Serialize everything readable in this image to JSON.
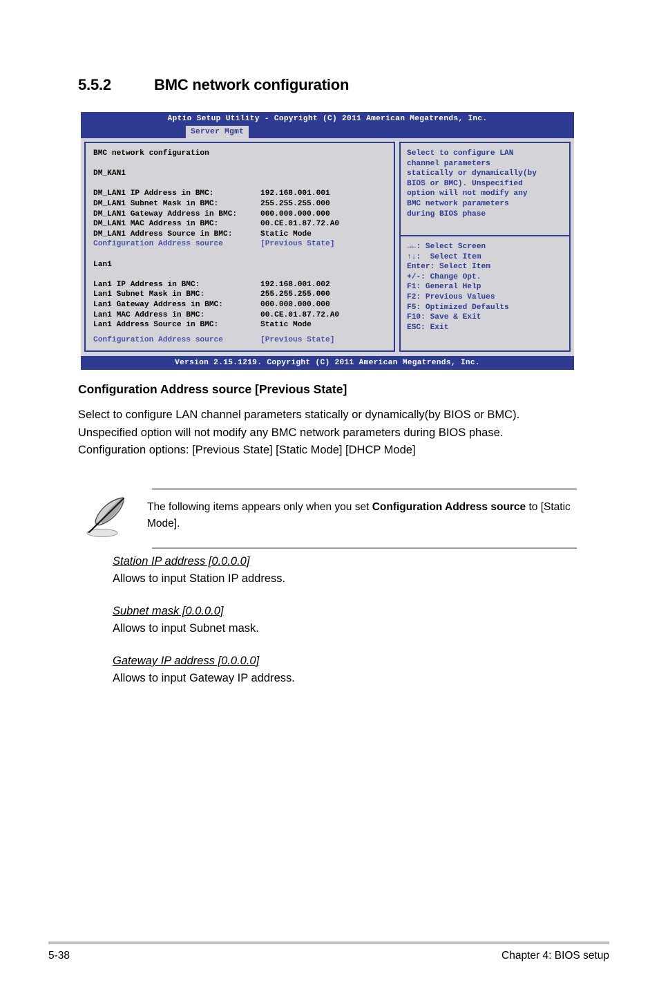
{
  "section": {
    "number": "5.5.2",
    "title": "BMC network configuration"
  },
  "bios": {
    "titlebar": "Aptio Setup Utility - Copyright (C) 2011 American Megatrends, Inc.",
    "tab": "Server Mgmt",
    "statusbar": "Version 2.15.1219. Copyright (C) 2011 American Megatrends, Inc.",
    "screen_title": "BMC network configuration",
    "groups": [
      {
        "name": "DM_KAN1",
        "rows": [
          {
            "label": "DM_LAN1 IP Address in BMC:",
            "value": "192.168.001.001"
          },
          {
            "label": "DM_LAN1 Subnet Mask in BMC:",
            "value": "255.255.255.000"
          },
          {
            "label": "DM_LAN1 Gateway Address in BMC:",
            "value": "000.000.000.000"
          },
          {
            "label": "DM_LAN1 MAC Address in BMC:",
            "value": "00.CE.01.87.72.A0"
          },
          {
            "label": "DM_LAN1 Address Source in BMC:",
            "value": "Static Mode"
          }
        ],
        "setting": {
          "label": "Configuration Address source",
          "value": "[Previous State]"
        }
      },
      {
        "name": "Lan1",
        "rows": [
          {
            "label": "Lan1 IP Address in BMC:",
            "value": "192.168.001.002"
          },
          {
            "label": "Lan1 Subnet Mask in BMC:",
            "value": "255.255.255.000"
          },
          {
            "label": "Lan1 Gateway Address in BMC:",
            "value": "000.000.000.000"
          },
          {
            "label": "Lan1 MAC Address in BMC:",
            "value": "00.CE.01.87.72.A0"
          },
          {
            "label": "Lan1 Address Source in BMC:",
            "value": "Static Mode"
          }
        ],
        "setting": {
          "label": "Configuration Address source",
          "value": "[Previous State]"
        }
      }
    ],
    "help_lines": [
      "Select to configure LAN",
      "channel parameters",
      "statically or dynamically(by",
      "BIOS or BMC). Unspecified",
      "option will not modify any",
      "BMC network parameters",
      "during BIOS phase"
    ],
    "key_lines": [
      "→←: Select Screen",
      "↑↓:  Select Item",
      "Enter: Select Item",
      "+/-: Change Opt.",
      "F1: General Help",
      "F2: Previous Values",
      "F5: Optimized Defaults",
      "F10: Save & Exit",
      "ESC: Exit"
    ],
    "colors": {
      "chrome_blue": "#2e3b93",
      "panel_gray": "#d4d4d8",
      "link_blue": "#4a53a8"
    }
  },
  "detail": {
    "heading": "Configuration Address source [Previous State]",
    "paragraph": "Select to configure LAN channel parameters statically or dynamically(by BIOS or BMC). Unspecified option will not modify any BMC network parameters during BIOS phase.",
    "options_line": "Configuration options: [Previous State] [Static Mode] [DHCP Mode]"
  },
  "note": {
    "icon": "quill-pen-icon",
    "text_before": "The following items appears only when you set ",
    "text_bold": "Configuration Address source",
    "text_after": " to [Static Mode]."
  },
  "items": [
    {
      "title": "Station IP address [0.0.0.0]",
      "desc": "Allows to input Station IP address."
    },
    {
      "title": "Subnet mask [0.0.0.0]",
      "desc": "Allows to input Subnet mask."
    },
    {
      "title": "Gateway IP address [0.0.0.0]",
      "desc": "Allows to input Gateway IP address."
    }
  ],
  "footer": {
    "page": "5-38",
    "chapter": "Chapter 4: BIOS setup"
  }
}
